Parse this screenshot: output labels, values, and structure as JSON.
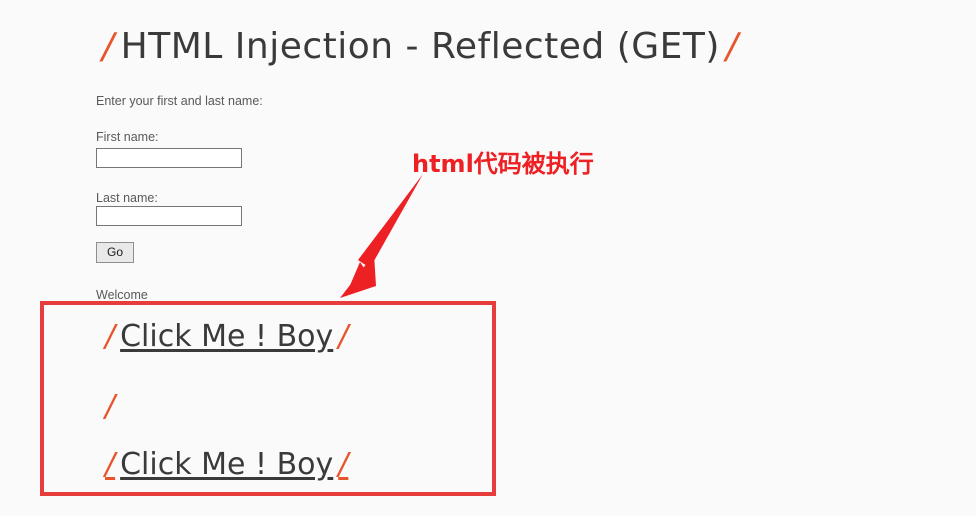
{
  "page": {
    "title_slash_left": "/",
    "title": "HTML Injection - Reflected (GET)",
    "title_slash_right": "/",
    "background_color": "#fafafa"
  },
  "form": {
    "intro_label": "Enter your first and last name:",
    "first_name": {
      "label": "First name:",
      "value": "",
      "placeholder": ""
    },
    "last_name": {
      "label": "Last name:",
      "value": "",
      "placeholder": ""
    },
    "submit_label": "Go"
  },
  "output": {
    "welcome_text": "Welcome",
    "lines": [
      {
        "slash_left": "/",
        "link_text": "Click Me ! Boy",
        "slash_right": "/"
      },
      {
        "slash_left": "/",
        "link_text": "",
        "slash_right": ""
      },
      {
        "slash_left": "/",
        "link_text": "Click Me ! Boy",
        "slash_right": "/"
      }
    ]
  },
  "annotation": {
    "text": "html代码被执行",
    "color": "#ed2024",
    "arrow_color": "#ed2024",
    "highlight_box_color": "#e63c3c"
  }
}
